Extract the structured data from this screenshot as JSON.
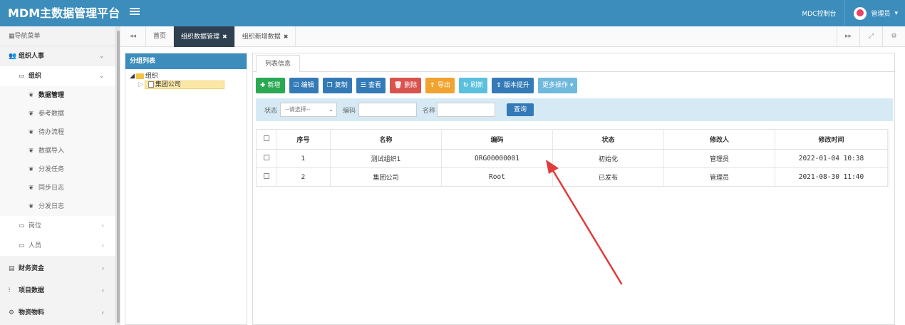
{
  "header": {
    "title": "MDM主数据管理平台",
    "console": "MDC控制台",
    "user": "管理员"
  },
  "sidebar": {
    "nav_title": "导航菜单",
    "groups": [
      {
        "label": "组织人事"
      },
      {
        "label": "组织"
      },
      {
        "label": "岗位"
      },
      {
        "label": "人员"
      },
      {
        "label": "财务资金"
      },
      {
        "label": "项目数据"
      },
      {
        "label": "物资物料"
      }
    ],
    "org_items": [
      "数据管理",
      "参考数据",
      "待办流程",
      "数据导入",
      "分发任务",
      "同步日志",
      "分发日志"
    ]
  },
  "tabs": {
    "home": "首页",
    "items": [
      "组织数据管理",
      "组织新增数据"
    ]
  },
  "tree": {
    "title": "分组列表",
    "root": "组织",
    "child": "集团公司"
  },
  "main": {
    "tab": "列表信息",
    "buttons": [
      "新增",
      "编辑",
      "复制",
      "查看",
      "删除",
      "导出",
      "刷新",
      "版本提升",
      "更多操作"
    ],
    "search": {
      "status_label": "状态",
      "status_value": "--请选择--",
      "code_label": "编码",
      "name_label": "名称",
      "query_button": "查询"
    },
    "table": {
      "headers": [
        "序号",
        "名称",
        "编码",
        "状态",
        "修改人",
        "修改时间"
      ],
      "rows": [
        [
          "1",
          "测试组织1",
          "ORG00000001",
          "初始化",
          "管理员",
          "2022-01-04 10:38"
        ],
        [
          "2",
          "集团公司",
          "Root",
          "已发布",
          "管理员",
          "2021-08-30 11:40"
        ]
      ]
    }
  },
  "colors": {
    "header_bg": "#3c8dbc",
    "active_tab": "#2f4050",
    "arrow": "#e03c3c"
  }
}
